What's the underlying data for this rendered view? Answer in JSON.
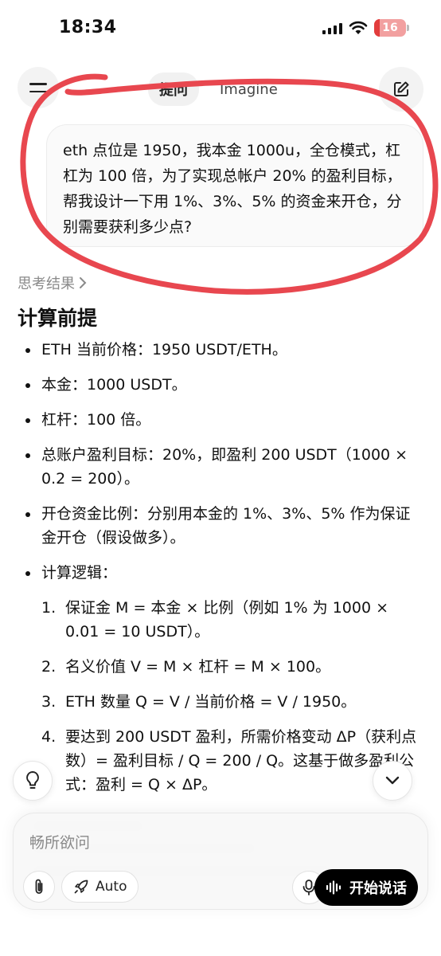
{
  "status_bar": {
    "time": "18:34",
    "battery": "16"
  },
  "header": {
    "tabs": [
      {
        "label": "提问"
      },
      {
        "label": "Imagine"
      }
    ]
  },
  "user_message": {
    "text": "eth 点位是 1950，我本金 1000u，全仓模式，杠杠为 100 倍，为了实现总帐户 20% 的盈利目标，帮我设计一下用 1%、3%、5% 的资金来开仓，分别需要获利多少点?"
  },
  "response": {
    "think_label": "思考结果",
    "section_title": "计算前提",
    "bullets": [
      "ETH 当前价格：1950 USDT/ETH。",
      "本金：1000 USDT。",
      "杠杆：100 倍。",
      "总账户盈利目标：20%，即盈利 200 USDT（1000 × 0.2 = 200）。",
      "开仓资金比例：分别用本金的 1%、3%、5% 作为保证金开仓（假设做多）。",
      "计算逻辑："
    ],
    "steps": [
      {
        "num": "1.",
        "text": "保证金 M = 本金 × 比例（例如 1% 为 1000 × 0.01 = 10 USDT）。"
      },
      {
        "num": "2.",
        "text": "名义价值 V = M × 杠杆 = M × 100。"
      },
      {
        "num": "3.",
        "text": "ETH 数量 Q = V / 当前价格 = V / 1950。"
      },
      {
        "num": "4.",
        "text": "要达到 200 USDT 盈利，所需价格变动 ΔP（获利点数）= 盈利目标 / Q = 200 / Q。这基于做多盈利公式：盈利 = Q × ΔP。"
      }
    ]
  },
  "composer": {
    "placeholder": "畅所欲问",
    "auto_label": "Auto",
    "voice_label": "开始说话"
  },
  "colors": {
    "annotation": "#e8474f",
    "accent": "#000000"
  },
  "icons": [
    "menu-icon",
    "edit-icon",
    "lightbulb-icon",
    "chevron-down-icon",
    "paperclip-icon",
    "rocket-icon",
    "mic-icon",
    "waveform-icon",
    "chevron-right-icon"
  ]
}
